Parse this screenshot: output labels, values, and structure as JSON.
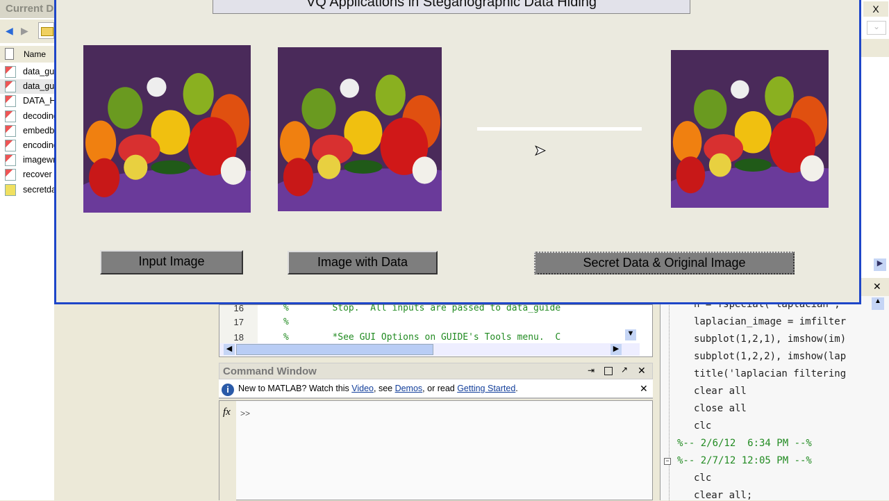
{
  "current_directory": {
    "title": "Current Directory",
    "column_name": "Name",
    "files": [
      "data_gui.fig",
      "data_gui.m",
      "DATA_HIDING",
      "decoding",
      "embedbits",
      "encoding",
      "imagewrite",
      "recover",
      "secretdata"
    ]
  },
  "figure": {
    "title": "VQ Applications in Steganographic Data Hiding",
    "buttons": {
      "input": "Input Image",
      "with_data": "Image with Data",
      "secret": "Secret Data & Original Image"
    },
    "progress": 1.0
  },
  "editor": {
    "lines": [
      {
        "n": "16",
        "t": "%        Stop.  All inputs are passed to data_guide"
      },
      {
        "n": "17",
        "t": "%"
      },
      {
        "n": "18",
        "t": "%        *See GUI Options on GUIDE's Tools menu.  C"
      }
    ]
  },
  "command_window": {
    "title": "Command Window",
    "info_prefix": "New to MATLAB? Watch this ",
    "link_video": "Video",
    "info_mid1": ", see ",
    "link_demos": "Demos",
    "info_mid2": ", or read ",
    "link_started": "Getting Started",
    "info_end": ".",
    "prompt": ">>",
    "fx": "fx"
  },
  "history": {
    "lines": [
      "h = fspecial('laplacian',",
      "laplacian_image = imfilter",
      "subplot(1,2,1), imshow(im)",
      "subplot(1,2,2), imshow(lap",
      "title('laplacian filtering",
      "clear all",
      "close all",
      "clc",
      "%-- 2/6/12  6:34 PM --%",
      "%-- 2/7/12 12:05 PM --%",
      "clc",
      "clear all;"
    ]
  }
}
